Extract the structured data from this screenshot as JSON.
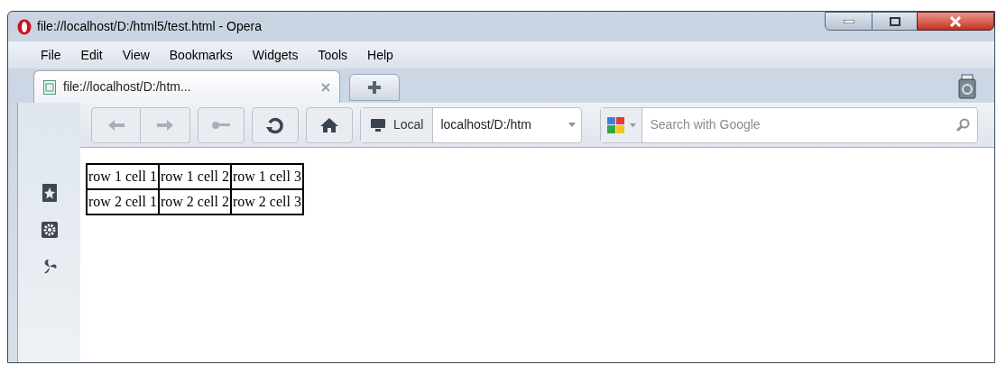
{
  "window": {
    "title": "file://localhost/D:/html5/test.html - Opera"
  },
  "menu": [
    "File",
    "Edit",
    "View",
    "Bookmarks",
    "Widgets",
    "Tools",
    "Help"
  ],
  "tabs": [
    {
      "label": "file://localhost/D:/htm...",
      "selected": true
    }
  ],
  "toolbar": {
    "location_badge": "Local",
    "address": "localhost/D:/htm",
    "search": {
      "placeholder": "Search with Google"
    }
  },
  "table": {
    "rows": [
      [
        "row 1 cell 1",
        "row 1 cell 2",
        "row 1 cell 3"
      ],
      [
        "row 2 cell 1",
        "row 2 cell 2",
        "row 2 cell 3"
      ]
    ]
  }
}
